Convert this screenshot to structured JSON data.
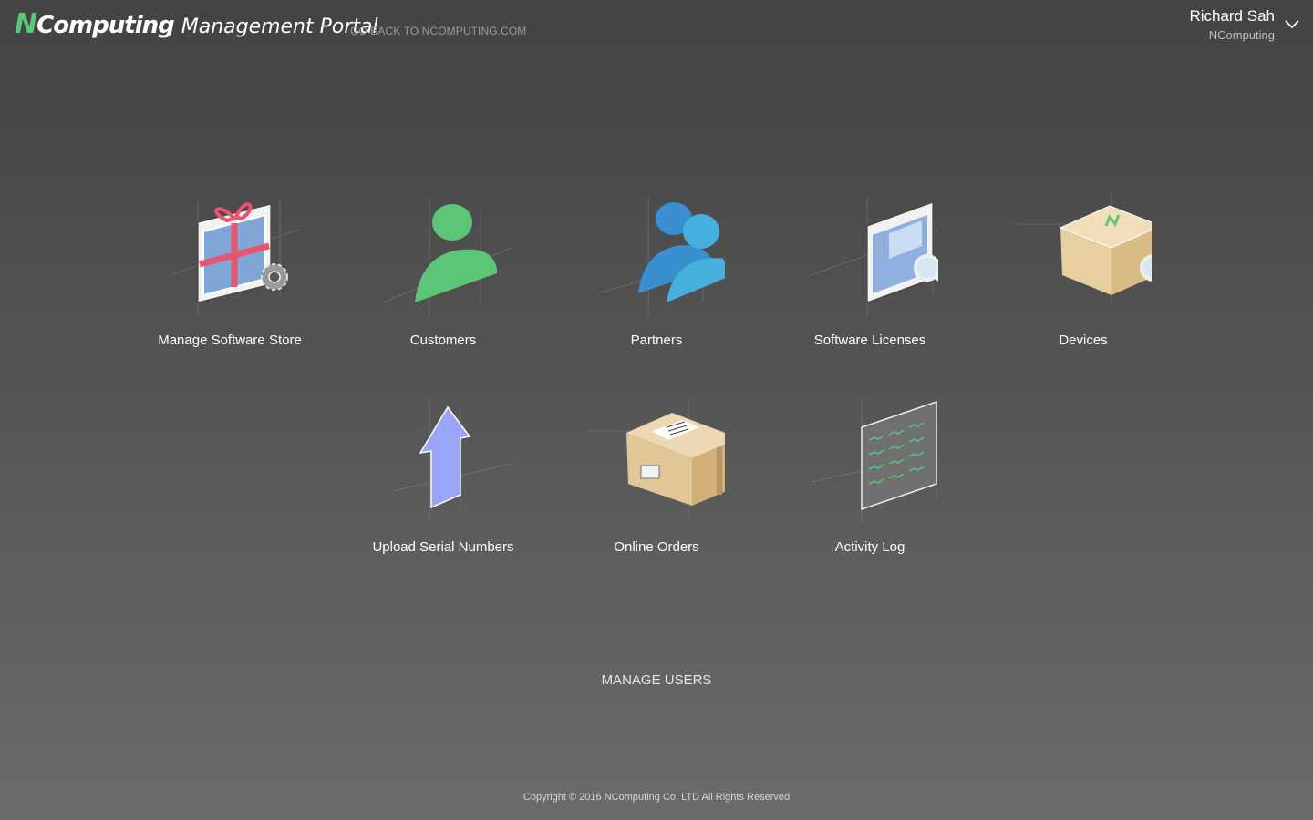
{
  "header": {
    "logo_n": "N",
    "logo_rest": "Computing",
    "portal_title": "Management Portal",
    "back_link": "GO BACK TO NCOMPUTING.COM"
  },
  "user": {
    "name": "Richard Sah",
    "org": "NComputing",
    "menu_icon": "chevron-down-icon"
  },
  "tiles": [
    {
      "label": "Manage Software Store",
      "icon": "software-store-icon"
    },
    {
      "label": "Customers",
      "icon": "customer-icon"
    },
    {
      "label": "Partners",
      "icon": "partners-icon"
    },
    {
      "label": "Software Licenses",
      "icon": "software-licenses-icon"
    },
    {
      "label": "Devices",
      "icon": "devices-icon"
    },
    {
      "label": "Upload Serial Numbers",
      "icon": "upload-arrow-icon"
    },
    {
      "label": "Online Orders",
      "icon": "package-icon"
    },
    {
      "label": "Activity Log",
      "icon": "activity-log-icon"
    }
  ],
  "manage_users": "MANAGE USERS",
  "footer": "Copyright © 2016 NComputing Co. LTD All Rights Reserved",
  "colors": {
    "brand_green": "#5bc776",
    "partner_blue": "#3a8fd0",
    "upload_purple": "#9aa6f5"
  }
}
